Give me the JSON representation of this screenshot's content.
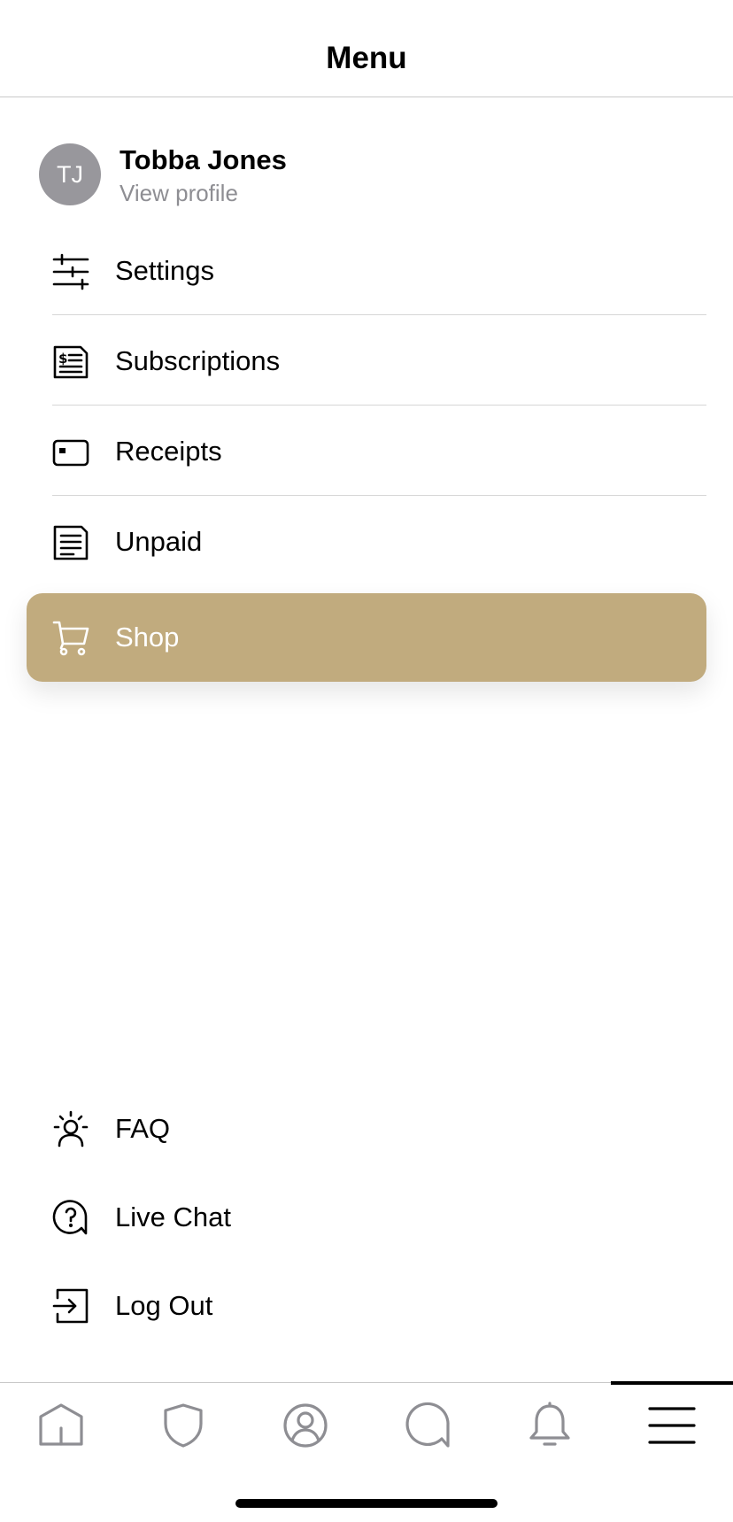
{
  "header": {
    "title": "Menu"
  },
  "profile": {
    "initials": "TJ",
    "name": "Tobba Jones",
    "link_label": "View profile",
    "avatar_color": "#98979c"
  },
  "menu": {
    "items": [
      {
        "label": "Settings",
        "icon": "sliders-icon"
      },
      {
        "label": "Subscriptions",
        "icon": "dollar-document-icon"
      },
      {
        "label": "Receipts",
        "icon": "card-icon"
      },
      {
        "label": "Unpaid",
        "icon": "document-lines-icon"
      }
    ],
    "highlighted": {
      "label": "Shop",
      "icon": "cart-icon",
      "color": "#c1ab7e"
    }
  },
  "footer_menu": {
    "items": [
      {
        "label": "FAQ",
        "icon": "lightbulb-person-icon"
      },
      {
        "label": "Live Chat",
        "icon": "question-bubble-icon"
      },
      {
        "label": "Log Out",
        "icon": "logout-icon"
      }
    ]
  },
  "tabbar": {
    "tabs": [
      {
        "name": "home",
        "icon": "home-icon",
        "active": false
      },
      {
        "name": "shield",
        "icon": "shield-icon",
        "active": false
      },
      {
        "name": "profile",
        "icon": "user-circle-icon",
        "active": false
      },
      {
        "name": "chat",
        "icon": "chat-bubble-icon",
        "active": false
      },
      {
        "name": "notifications",
        "icon": "bell-icon",
        "active": false
      },
      {
        "name": "menu",
        "icon": "hamburger-icon",
        "active": true
      }
    ],
    "inactive_color": "#8e8e93",
    "active_color": "#000000"
  }
}
